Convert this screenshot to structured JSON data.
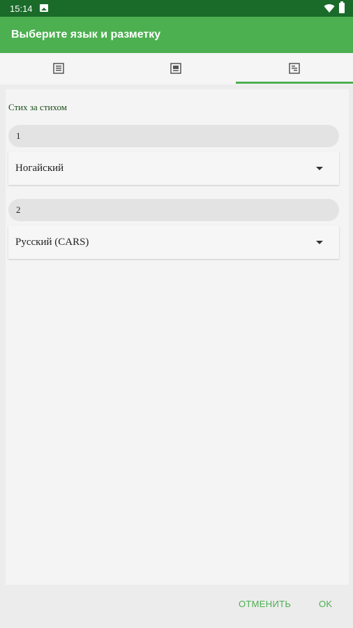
{
  "status_bar": {
    "time": "15:14"
  },
  "app_bar": {
    "title": "Выберите язык и разметку"
  },
  "tabs": [
    {
      "icon": "document-icon"
    },
    {
      "icon": "document-image-icon"
    },
    {
      "icon": "document-lines-icon",
      "selected": true
    }
  ],
  "section": {
    "label": "Стих за стихом",
    "slots": [
      {
        "number": "1",
        "language": "Ногайский"
      },
      {
        "number": "2",
        "language": "Русский (CARS)"
      }
    ]
  },
  "footer": {
    "cancel_label": "ОТМЕНИТЬ",
    "ok_label": "OK"
  },
  "colors": {
    "accent": "#4caf50",
    "status_bar": "#1a6b2a"
  }
}
